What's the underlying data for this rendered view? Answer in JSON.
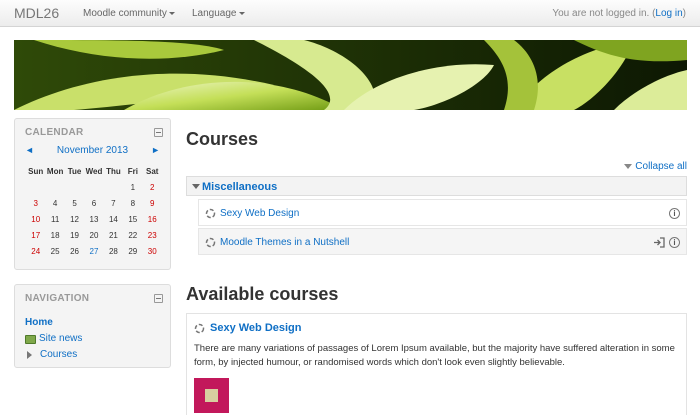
{
  "navbar": {
    "brand": "MDL26",
    "menu1": "Moodle community",
    "menu2": "Language",
    "login_prefix": "You are not logged in. (",
    "login_link": "Log in",
    "login_suffix": ")"
  },
  "calendar": {
    "title": "CALENDAR",
    "month": "November 2013",
    "prev": "◄",
    "next": "►",
    "days": [
      "Sun",
      "Mon",
      "Tue",
      "Wed",
      "Thu",
      "Fri",
      "Sat"
    ],
    "weeks": [
      [
        "",
        "",
        "",
        "",
        "",
        "1",
        "2"
      ],
      [
        "3",
        "4",
        "5",
        "6",
        "7",
        "8",
        "9"
      ],
      [
        "10",
        "11",
        "12",
        "13",
        "14",
        "15",
        "16"
      ],
      [
        "17",
        "18",
        "19",
        "20",
        "21",
        "22",
        "23"
      ],
      [
        "24",
        "25",
        "26",
        "27",
        "28",
        "29",
        "30"
      ]
    ],
    "today": "27"
  },
  "navigation": {
    "title": "NAVIGATION",
    "home": "Home",
    "site_news": "Site news",
    "courses": "Courses"
  },
  "main": {
    "courses_heading": "Courses",
    "collapse_all": "Collapse all",
    "category": "Miscellaneous",
    "course_list": [
      "Sexy Web Design",
      "Moodle Themes in a Nutshell"
    ],
    "available_heading": "Available courses",
    "available_course": {
      "title": "Sexy Web Design",
      "summary": "There are many variations of passages of Lorem Ipsum available, but the majority have suffered alteration in some form, by injected humour, or randomised words which don't look even slightly believable."
    }
  }
}
